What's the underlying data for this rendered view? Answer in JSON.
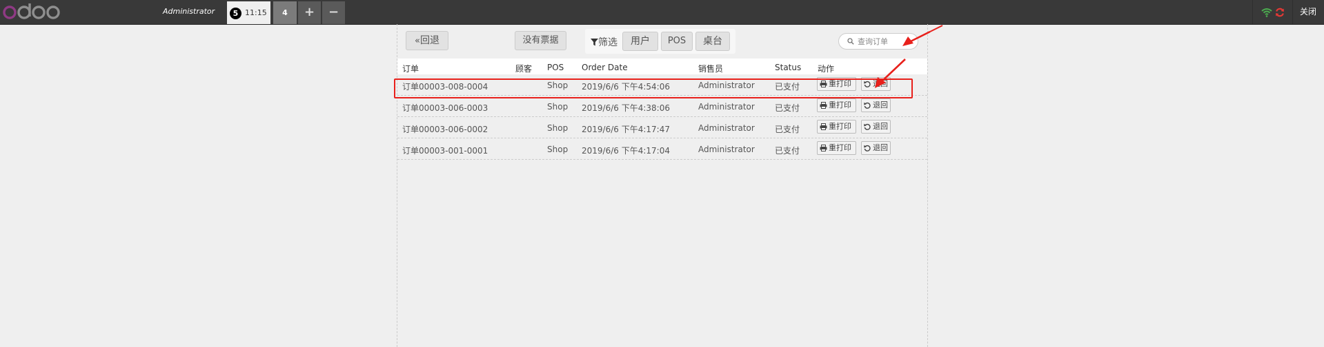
{
  "topbar": {
    "user_name": "Administrator",
    "orders": [
      {
        "badge": "5",
        "time": "11:15",
        "active": true
      },
      {
        "label": "4",
        "active": false
      }
    ],
    "add_label": "+",
    "remove_label": "−",
    "close_label": "关闭",
    "icons": [
      "odoo-logo",
      "wifi-icon",
      "sync-icon"
    ],
    "colors": {
      "bar": "#393939",
      "wifi": "#4caf50",
      "sync": "#e53935",
      "logo_o": "#8f3a84"
    }
  },
  "toolbar": {
    "back_label": "回退",
    "no_receipt_label": "没有票据",
    "filter_label": "筛选",
    "filters": [
      "用户",
      "POS",
      "桌台"
    ],
    "search_placeholder": "查询订单"
  },
  "table": {
    "headers": [
      "订单",
      "顾客",
      "POS",
      "Order Date",
      "销售员",
      "Status",
      "动作"
    ],
    "rows": [
      {
        "order": "订单00003-008-0004",
        "customer": "",
        "pos": "Shop",
        "date": "2019/6/6 下午4:54:06",
        "seller": "Administrator",
        "status": "已支付"
      },
      {
        "order": "订单00003-006-0003",
        "customer": "",
        "pos": "Shop",
        "date": "2019/6/6 下午4:38:06",
        "seller": "Administrator",
        "status": "已支付"
      },
      {
        "order": "订单00003-006-0002",
        "customer": "",
        "pos": "Shop",
        "date": "2019/6/6 下午4:17:47",
        "seller": "Administrator",
        "status": "已支付"
      },
      {
        "order": "订单00003-001-0001",
        "customer": "",
        "pos": "Shop",
        "date": "2019/6/6 下午4:17:04",
        "seller": "Administrator",
        "status": "已支付"
      }
    ],
    "actions": {
      "reprint_label": "重打印",
      "return_label": "退回"
    }
  },
  "annotations": {
    "color": "#e8201b"
  }
}
